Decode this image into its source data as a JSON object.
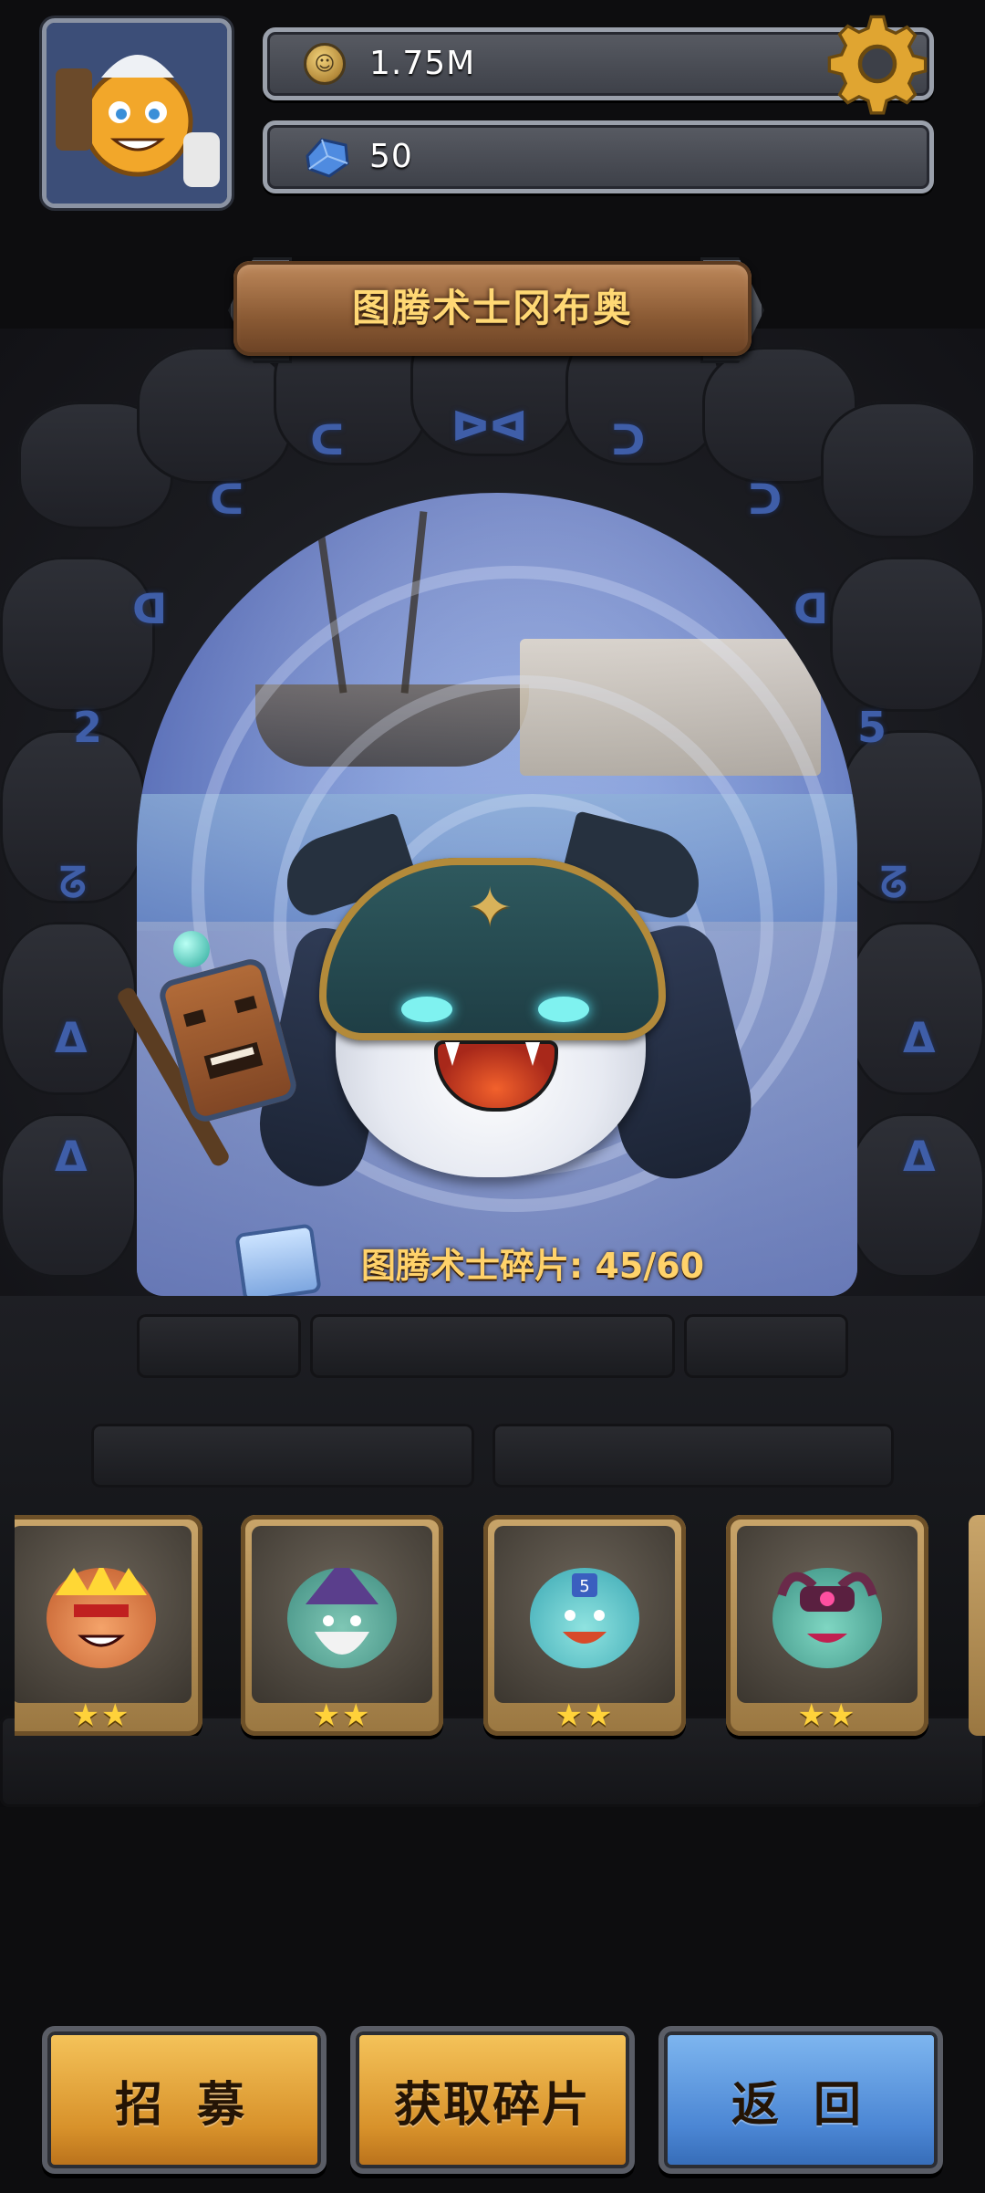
{
  "header": {
    "coins": "1.75M",
    "gems": "50"
  },
  "hero": {
    "title": "图腾术士冈布奥",
    "shard_label": "图腾术士碎片:",
    "shard_count": "45/60",
    "shard_progress": 0.75
  },
  "cards": [
    {
      "name": "hero-card-spiky",
      "stars": "★★"
    },
    {
      "name": "hero-card-wizard",
      "stars": "★★"
    },
    {
      "name": "hero-card-torch",
      "stars": "★★"
    },
    {
      "name": "hero-card-demon",
      "stars": "★★"
    }
  ],
  "buttons": {
    "recruit": "招 募",
    "get_shards": "获取碎片",
    "back": "返 回"
  },
  "colors": {
    "accent_gold": "#ffd26a",
    "button_gold": "#f5c45b",
    "button_blue": "#7fb7f0"
  }
}
